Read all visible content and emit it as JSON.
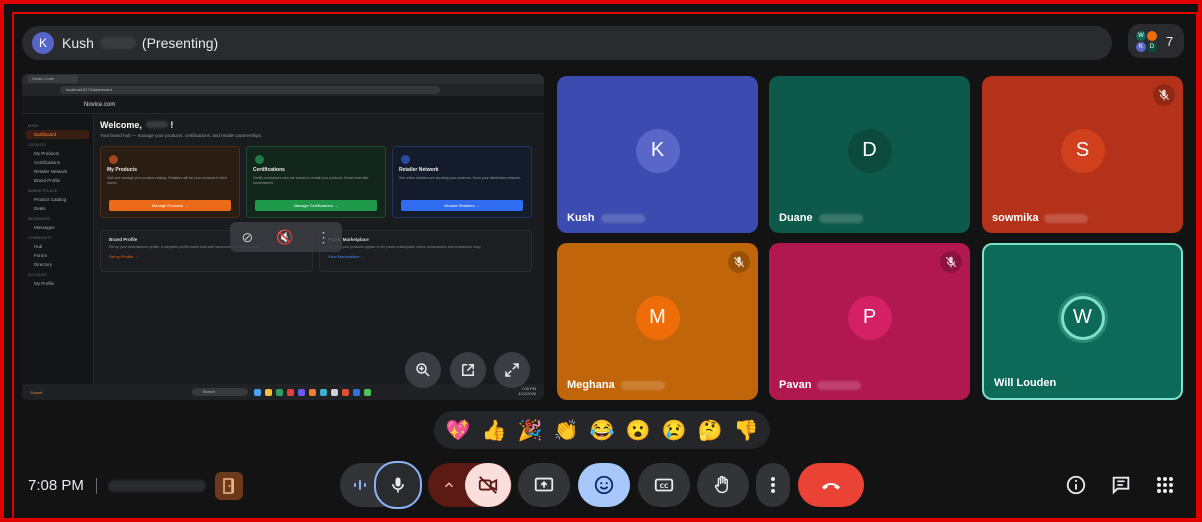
{
  "topbar": {
    "presenter_initial": "K",
    "presenter_name": "Kush",
    "presenting_label": "(Presenting)",
    "participant_count": "7",
    "mini_avatars": [
      "W",
      "D",
      "K"
    ]
  },
  "shared_screen": {
    "browser_tab": "Studio Code",
    "url": "localhost:5173/dashboard",
    "brand": "Novice.com",
    "welcome": "Welcome,",
    "welcome_sub": "Your brand hub — manage your products, certifications, and retailer partnerships.",
    "sidebar": [
      {
        "section": "MAIN",
        "items": [
          "Dashboard"
        ]
      },
      {
        "section": "CATALOG",
        "items": [
          "My Products",
          "Certifications",
          "Retailer Network",
          "Brand Profile"
        ]
      },
      {
        "section": "MARKETPLACE",
        "items": [
          "Product Catalog",
          "Deals"
        ]
      },
      {
        "section": "MESSAGES",
        "items": [
          "Messages"
        ]
      },
      {
        "section": "COMMUNITY",
        "items": [
          "Hub",
          "Forum",
          "Directory"
        ]
      },
      {
        "section": "ACCOUNT",
        "items": [
          "My Profile"
        ]
      }
    ],
    "cards": [
      {
        "title": "My Products",
        "desc": "Add and manage your product catalog. Retailers will list your products in their stores.",
        "button": "Manage Products →"
      },
      {
        "title": "Certifications",
        "desc": "Certify contractors who are trained to install your products. Boost trust with homeowners.",
        "button": "Manage Certifications →"
      },
      {
        "title": "Retailer Network",
        "desc": "See which retailers are stocking your products. Grow your distribution network.",
        "button": "Browse Retailers →"
      }
    ],
    "cards2": [
      {
        "title": "Brand Profile",
        "desc": "Set up your manufacturer profile. A complete profile builds trust with homeowners and contractors.",
        "link": "Set up Profile →"
      },
      {
        "title": "Public Marketplace",
        "desc": "See how your products appear in the public marketplace where homeowners and contractors shop.",
        "link": "View Marketplace →"
      }
    ],
    "taskbar_search": "Search",
    "taskbar_time": "7:08 PM",
    "taskbar_date": "4/12/2026",
    "taskbar_weather": "Sunset"
  },
  "tiles": [
    {
      "initial": "K",
      "name": "Kush",
      "color": "#3b4bb0",
      "avatar": "#5a67c9",
      "muted": false
    },
    {
      "initial": "D",
      "name": "Duane",
      "color": "#0e5a4a",
      "avatar": "#0b4a3c",
      "muted": false
    },
    {
      "initial": "S",
      "name": "sowmika",
      "color": "#b4321a",
      "avatar": "#d0401c",
      "muted": true
    },
    {
      "initial": "M",
      "name": "Meghana",
      "color": "#c0650a",
      "avatar": "#ee6d08",
      "muted": true
    },
    {
      "initial": "P",
      "name": "Pavan",
      "color": "#b0184e",
      "avatar": "#d42064",
      "muted": true
    },
    {
      "initial": "W",
      "name": "Will Louden",
      "color": "#0e6a58",
      "avatar": "#0e6a58",
      "muted": false
    }
  ],
  "reactions": [
    "💖",
    "👍",
    "🎉",
    "👏",
    "😂",
    "😮",
    "😢",
    "🤔",
    "👎"
  ],
  "bottom": {
    "time": "7:08 PM"
  },
  "colors": {
    "accent_blue": "#8ab4f8",
    "end_call": "#ea4335",
    "cam_off": "#f9dedc"
  }
}
